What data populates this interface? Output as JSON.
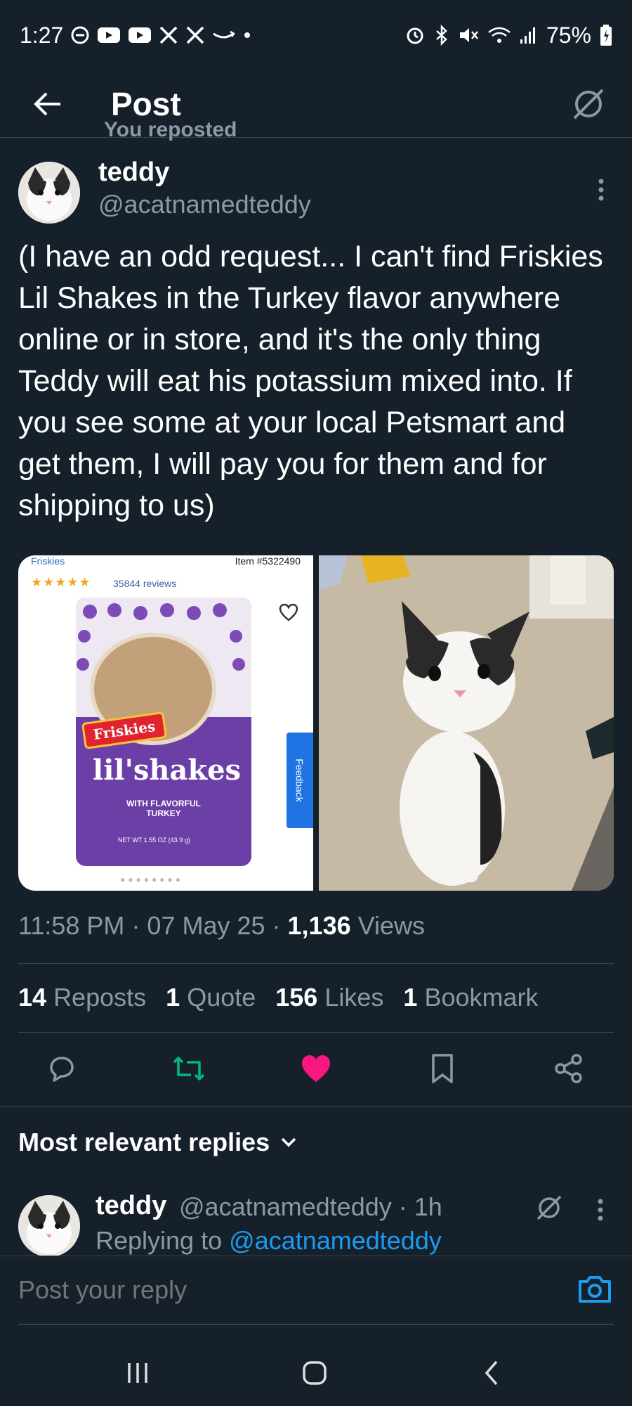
{
  "status_bar": {
    "time": "1:27",
    "battery": "75%"
  },
  "header": {
    "title": "Post"
  },
  "repost_label": "You reposted",
  "post": {
    "author_name": "teddy",
    "author_handle": "@acatnamedteddy",
    "text": "(I have an odd request... I can't find Friskies Lil Shakes in the Turkey flavor anywhere online or in store, and it's the only thing Teddy will eat his potassium mixed into. If you see some at your local Petsmart and get them, I will pay you for them and for shipping to us)",
    "media": {
      "left": {
        "brand": "Friskies",
        "item": "Item #5322490",
        "stars": "★★★★★",
        "reviews": "35844 reviews",
        "logo_text": "Friskies",
        "product_name": "lil'shakes",
        "product_sub": "WITH FLAVORFUL TURKEY",
        "net_wt": "NET WT 1.55 OZ (43.9 g)",
        "feedback": "Feedback"
      }
    },
    "time": "11:58 PM",
    "date": "07 May 25",
    "views_count": "1,136",
    "views_label": "Views",
    "stats": {
      "reposts_count": "14",
      "reposts_label": "Reposts",
      "quotes_count": "1",
      "quotes_label": "Quote",
      "likes_count": "156",
      "likes_label": "Likes",
      "bookmarks_count": "1",
      "bookmarks_label": "Bookmark"
    }
  },
  "colors": {
    "background": "#15202b",
    "accent": "#1d9bf0",
    "like": "#f91880",
    "repost": "#00ba7c",
    "muted": "#8b98a5"
  },
  "replies": {
    "header": "Most relevant replies",
    "items": [
      {
        "name": "teddy",
        "meta": "@acatnamedteddy · 1h",
        "replying_prefix": "Replying to",
        "replying_handle": "@acatnamedteddy"
      }
    ]
  },
  "composer": {
    "placeholder": "Post your reply"
  }
}
